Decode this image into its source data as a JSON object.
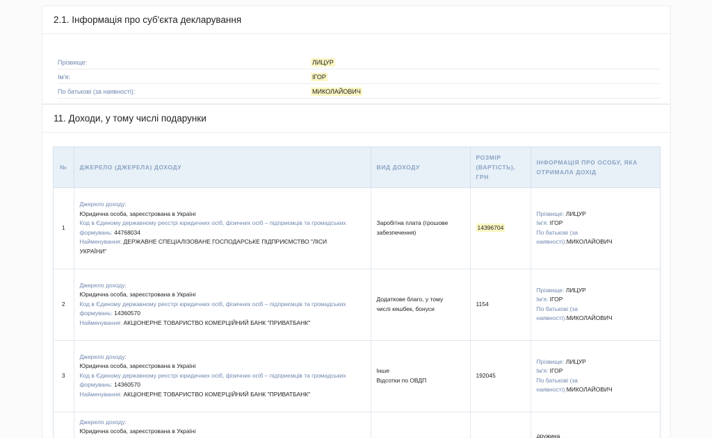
{
  "section21": {
    "title": "2.1. Інформація про суб'єкта декларування",
    "fields": [
      {
        "label": "Прізвище:",
        "value": "ЛИЦУР"
      },
      {
        "label": "Ім'я:",
        "value": "ІГОР"
      },
      {
        "label": "По батькові (за наявності):",
        "value": "МИКОЛАЙОВИЧ"
      }
    ]
  },
  "section11": {
    "title": "11. Доходи, у тому числі подарунки",
    "headers": {
      "num": "№",
      "source": "ДЖЕРЕЛО (ДЖЕРЕЛА) ДОХОДУ",
      "type": "ВИД ДОХОДУ",
      "amount_l1": "РОЗМІР",
      "amount_l2": "(ВАРТІСТЬ),",
      "amount_l3": "ГРН",
      "person_l1": "ІНФОРМАЦІЯ ПРО ОСОБУ, ЯКА",
      "person_l2": "ОТРИМАЛА ДОХІД"
    },
    "labels": {
      "source_label": "Джерело доходу:",
      "code_label_l1": "Код в Єдиному державному реєстрі юридичних осіб, фізичних осіб – підприємців та громадських",
      "code_label_l2": "формувань:",
      "name_label": "Найменування:",
      "surname_label": "Прізвище:",
      "firstname_label": "Ім'я:",
      "patronymic_label_l1": "По батькові (за",
      "patronymic_label_l2": "наявності):"
    },
    "rows": [
      {
        "num": "1",
        "entity": "Юридична особа, зареєстрована в Україні",
        "code": "44768034",
        "name_l1": "ДЕРЖАВНЕ СПЕЦІАЛІЗОВАНЕ ГОСПОДАРСЬКЕ ПІДПРИЄМСТВО \"ЛІСИ",
        "name_l2": "УКРАЇНИ\"",
        "type_l1": "Заробітна плата (грошове",
        "type_l2": "забезпечення)",
        "amount": "14396704",
        "surname": "ЛИЦУР",
        "firstname": "ІГОР",
        "patronymic": "МИКОЛАЙОВИЧ"
      },
      {
        "num": "2",
        "entity": "Юридична особа, зареєстрована в Україні",
        "code": "14360570",
        "name_l1": "АКЦІОНЕРНЕ ТОВАРИСТВО КОМЕРЦІЙНИЙ БАНК \"ПРИВАТБАНК\"",
        "type_l1": "Додаткове благо, у тому",
        "type_l2": "числі кешбек, бонуси",
        "amount": "1154",
        "surname": "ЛИЦУР",
        "firstname": "ІГОР",
        "patronymic": "МИКОЛАЙОВИЧ"
      },
      {
        "num": "3",
        "entity": "Юридична особа, зареєстрована в Україні",
        "code": "14360570",
        "name_l1": "АКЦІОНЕРНЕ ТОВАРИСТВО КОМЕРЦІЙНИЙ БАНК \"ПРИВАТБАНК\"",
        "type_l1": "Інше",
        "type_l2": "Відсотки по ОВДП",
        "amount": "192045",
        "surname": "ЛИЦУР",
        "firstname": "ІГОР",
        "patronymic": "МИКОЛАЙОВИЧ"
      },
      {
        "entity": "Юридична особа, зареєстрована в Україні",
        "person_relation": "дружина"
      }
    ]
  }
}
